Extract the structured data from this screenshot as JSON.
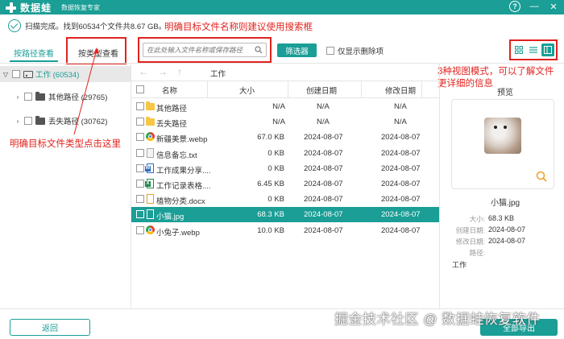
{
  "app": {
    "name": "数据蛙",
    "subtitle": "数据恢复专家",
    "help_label": "?",
    "minimize_label": "—",
    "close_label": "✕"
  },
  "status": {
    "text": "扫描完成。找到60534个文件共8.67 GB。"
  },
  "annotations": {
    "search_tip": "明确目标文件名称则建议使用搜索框",
    "view_tip_1": "3种视图模式，可以了解文件",
    "view_tip_2": "更详细的信息",
    "type_tip": "明确目标文件类型点击这里"
  },
  "tabs": [
    {
      "label": "按路径查看",
      "active": true
    },
    {
      "label": "按类型查看",
      "active": false
    }
  ],
  "search": {
    "placeholder": "在此处输入文件名称或保存路径"
  },
  "toolbar": {
    "filter_label": "筛选器",
    "show_deleted_label": "仅显示删除项"
  },
  "tree": {
    "root": {
      "label": "工作 (60534)"
    },
    "children": [
      {
        "label": "其他路径 (29765)"
      },
      {
        "label": "丢失路径 (30762)"
      }
    ]
  },
  "breadcrumb": {
    "current": "工作",
    "back": "←",
    "forward": "→",
    "up": "↑"
  },
  "table": {
    "headers": {
      "name": "名称",
      "size": "大小",
      "created": "创建日期",
      "modified": "修改日期"
    },
    "rows": [
      {
        "icon": "folder",
        "name": "其他路径",
        "size": "N/A",
        "created": "N/A",
        "modified": "N/A"
      },
      {
        "icon": "folder",
        "name": "丢失路径",
        "size": "N/A",
        "created": "N/A",
        "modified": "N/A"
      },
      {
        "icon": "webp",
        "name": "新疆美景.webp",
        "size": "67.0 KB",
        "created": "2024-08-07",
        "modified": "2024-08-07"
      },
      {
        "icon": "txt",
        "name": "信息备忘.txt",
        "size": "0 KB",
        "created": "2024-08-07",
        "modified": "2024-08-07"
      },
      {
        "icon": "doc",
        "name": "工作成果分享....",
        "size": "0 KB",
        "created": "2024-08-07",
        "modified": "2024-08-07"
      },
      {
        "icon": "xls",
        "name": "工作记录表格....",
        "size": "6.45 KB",
        "created": "2024-08-07",
        "modified": "2024-08-07"
      },
      {
        "icon": "docx",
        "name": "植物分类.docx",
        "size": "0 KB",
        "created": "2024-08-07",
        "modified": "2024-08-07"
      },
      {
        "icon": "img",
        "name": "小猫.jpg",
        "size": "68.3 KB",
        "created": "2024-08-07",
        "modified": "2024-08-07",
        "selected": true
      },
      {
        "icon": "webp",
        "name": "小兔子.webp",
        "size": "10.0 KB",
        "created": "2024-08-07",
        "modified": "2024-08-07"
      }
    ]
  },
  "preview": {
    "title": "预览",
    "file_name": "小猫.jpg",
    "labels": {
      "size": "大小:",
      "created": "创建日期:",
      "modified": "修改日期:",
      "path": "路径:"
    },
    "size": "68.3 KB",
    "created": "2024-08-07",
    "modified": "2024-08-07",
    "path": "工作"
  },
  "footer": {
    "back_label": "返回",
    "export_label": "全部导出",
    "watermark": "掘金技术社区 @ 数据蛙恢复软件"
  },
  "colors": {
    "accent": "#1a9e96",
    "annotation": "#e0231e"
  }
}
